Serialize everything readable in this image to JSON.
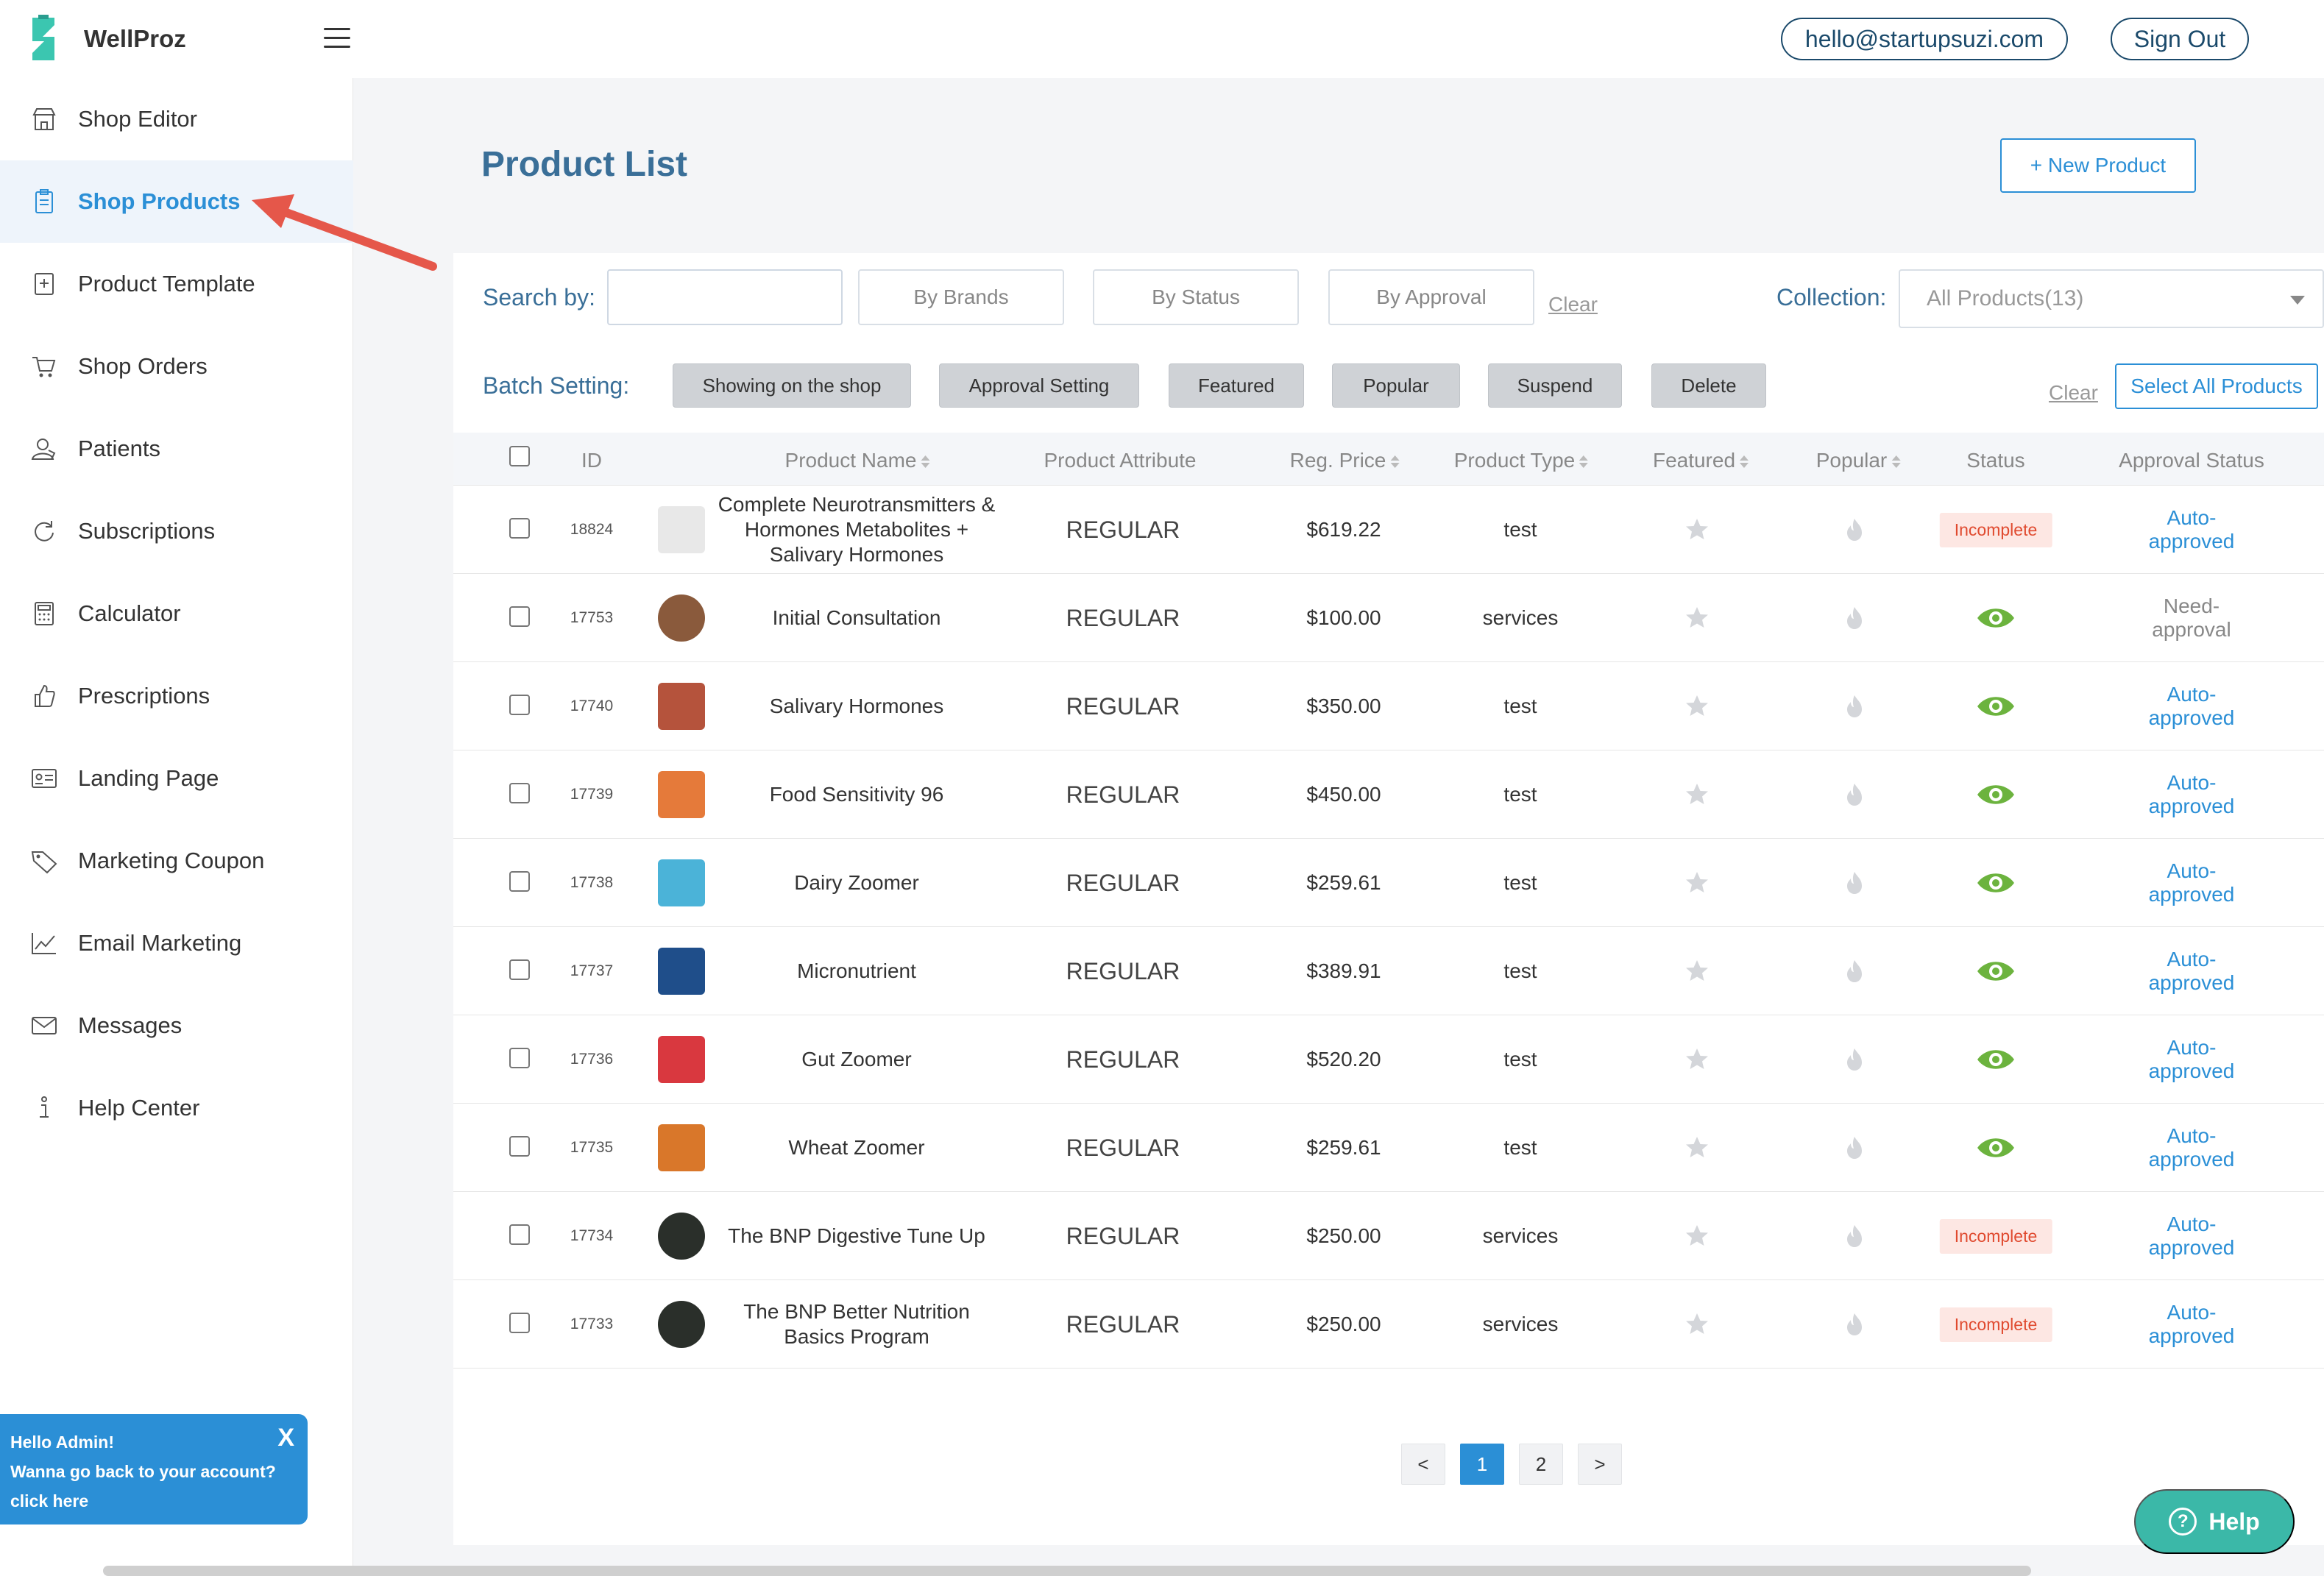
{
  "app": {
    "brand": "WellProz"
  },
  "header": {
    "email": "hello@startupsuzi.com",
    "sign_out": "Sign Out"
  },
  "sidebar": {
    "items": [
      {
        "label": "Shop Editor",
        "icon": "store-icon"
      },
      {
        "label": "Shop Products",
        "icon": "clipboard-icon",
        "active": true
      },
      {
        "label": "Product Template",
        "icon": "template-icon"
      },
      {
        "label": "Shop Orders",
        "icon": "cart-icon"
      },
      {
        "label": "Patients",
        "icon": "user-icon"
      },
      {
        "label": "Subscriptions",
        "icon": "refresh-icon"
      },
      {
        "label": "Calculator",
        "icon": "calculator-icon"
      },
      {
        "label": "Prescriptions",
        "icon": "thumbs-up-icon"
      },
      {
        "label": "Landing Page",
        "icon": "id-card-icon"
      },
      {
        "label": "Marketing Coupon",
        "icon": "tag-icon"
      },
      {
        "label": "Email Marketing",
        "icon": "chart-icon"
      },
      {
        "label": "Messages",
        "icon": "mail-icon"
      },
      {
        "label": "Help Center",
        "icon": "info-icon"
      }
    ]
  },
  "admin_box": {
    "line1": "Hello Admin!",
    "line2": "Wanna go back to your account?",
    "line3": "click here",
    "close": "X"
  },
  "main": {
    "title": "Product List",
    "new_product": "+ New Product",
    "search_label": "Search by:",
    "filters": [
      "By Brands",
      "By Status",
      "By Approval"
    ],
    "clear": "Clear",
    "collection_label": "Collection:",
    "collection_value": "All Products(13)",
    "batch_label": "Batch Setting:",
    "batch_buttons": [
      "Showing on the shop",
      "Approval Setting",
      "Featured",
      "Popular",
      "Suspend",
      "Delete"
    ],
    "batch_clear": "Clear",
    "select_all": "Select All Products"
  },
  "table": {
    "headers": [
      "ID",
      "Product Name",
      "Product Attribute",
      "Reg. Price",
      "Product Type",
      "Featured",
      "Popular",
      "Status",
      "Approval Status"
    ],
    "rows": [
      {
        "id": "18824",
        "name": "Complete Neurotransmitters & Hormones Metabolites + Salivary Hormones",
        "attribute": "REGULAR",
        "price": "$619.22",
        "type": "test",
        "status": "Incomplete",
        "approval": "Auto-approved",
        "thumb": "#e8e8e8"
      },
      {
        "id": "17753",
        "name": "Initial Consultation",
        "attribute": "REGULAR",
        "price": "$100.00",
        "type": "services",
        "status": "visible",
        "approval": "Need-approval",
        "thumb": "#8a5a3c"
      },
      {
        "id": "17740",
        "name": "Salivary Hormones",
        "attribute": "REGULAR",
        "price": "$350.00",
        "type": "test",
        "status": "visible",
        "approval": "Auto-approved",
        "thumb": "#b5533c"
      },
      {
        "id": "17739",
        "name": "Food Sensitivity 96",
        "attribute": "REGULAR",
        "price": "$450.00",
        "type": "test",
        "status": "visible",
        "approval": "Auto-approved",
        "thumb": "#e57a3a"
      },
      {
        "id": "17738",
        "name": "Dairy Zoomer",
        "attribute": "REGULAR",
        "price": "$259.61",
        "type": "test",
        "status": "visible",
        "approval": "Auto-approved",
        "thumb": "#4bb3d8"
      },
      {
        "id": "17737",
        "name": "Micronutrient",
        "attribute": "REGULAR",
        "price": "$389.91",
        "type": "test",
        "status": "visible",
        "approval": "Auto-approved",
        "thumb": "#1f4e8a"
      },
      {
        "id": "17736",
        "name": "Gut Zoomer",
        "attribute": "REGULAR",
        "price": "$520.20",
        "type": "test",
        "status": "visible",
        "approval": "Auto-approved",
        "thumb": "#d9383f"
      },
      {
        "id": "17735",
        "name": "Wheat Zoomer",
        "attribute": "REGULAR",
        "price": "$259.61",
        "type": "test",
        "status": "visible",
        "approval": "Auto-approved",
        "thumb": "#d9772a"
      },
      {
        "id": "17734",
        "name": "The BNP Digestive Tune Up",
        "attribute": "REGULAR",
        "price": "$250.00",
        "type": "services",
        "status": "Incomplete",
        "approval": "Auto-approved",
        "thumb": "#2a2f2a"
      },
      {
        "id": "17733",
        "name": "The BNP Better Nutrition Basics Program",
        "attribute": "REGULAR",
        "price": "$250.00",
        "type": "services",
        "status": "Incomplete",
        "approval": "Auto-approved",
        "thumb": "#2a2f2a"
      }
    ]
  },
  "pagination": {
    "prev": "<",
    "pages": [
      "1",
      "2"
    ],
    "next": ">",
    "current": "1"
  },
  "help": {
    "label": "Help",
    "q": "?"
  },
  "colors": {
    "accent": "#2b8fd6",
    "title": "#3a6f98",
    "status_green": "#6cb33e",
    "incomplete_bg": "#fde7e3",
    "incomplete_text": "#e04a2f",
    "arrow": "#e5574a"
  }
}
